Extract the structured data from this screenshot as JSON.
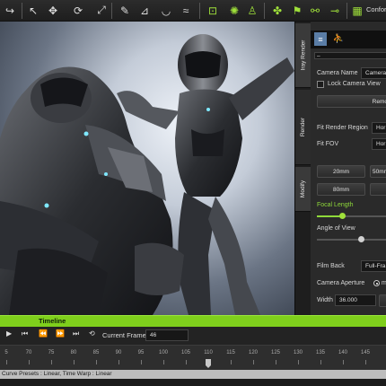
{
  "toolbar": {
    "conform_label": "Conform",
    "icons": [
      "redo-icon",
      "select-arrow-icon",
      "move-icon",
      "rotate-icon",
      "scale-icon",
      "brush-icon",
      "mirror-icon",
      "camera-green-icon",
      "flag-icon",
      "pose-icon",
      "actor-icon",
      "flag-green-icon",
      "bone-icon"
    ]
  },
  "side_tabs": [
    "Iray Render",
    "Render",
    "Modify"
  ],
  "panel": {
    "camera_name_label": "Camera Name",
    "camera_name_value": "Camera",
    "lock_camera_view_label": "Lock Camera View",
    "remove_button": "Remo",
    "fit_render_region_label": "Fit Render Region",
    "fit_render_region_value": "Hor",
    "fit_fov_label": "Fit FOV",
    "fit_fov_value": "Hor",
    "lens_20": "20mm",
    "lens_50": "50mm",
    "lens_80": "80mm",
    "focal_length_label": "Focal Length",
    "focal_length_level": 0.35,
    "angle_of_view_label": "Angle of View",
    "angle_of_view_level": 0.62,
    "film_back_label": "Film Back",
    "film_back_value": "Full-Fra",
    "camera_aperture_label": "Camera Aperture",
    "camera_aperture_option": "m",
    "width_label": "Width",
    "width_value": "36.000"
  },
  "timeline": {
    "title": "Timeline",
    "current_frame_label": "Current Frame",
    "current_frame_value": "46",
    "ticks": [
      "5",
      "70",
      "75",
      "80",
      "85",
      "90",
      "95",
      "100",
      "105",
      "110",
      "115",
      "120",
      "125",
      "130",
      "135",
      "140",
      "145"
    ],
    "playhead_frame": "110"
  },
  "status_text": "Curve Presets : Linear, Time Warp : Linear",
  "colors": {
    "accent": "#7fcf1c",
    "toolbar_green": "#9fe03a"
  }
}
